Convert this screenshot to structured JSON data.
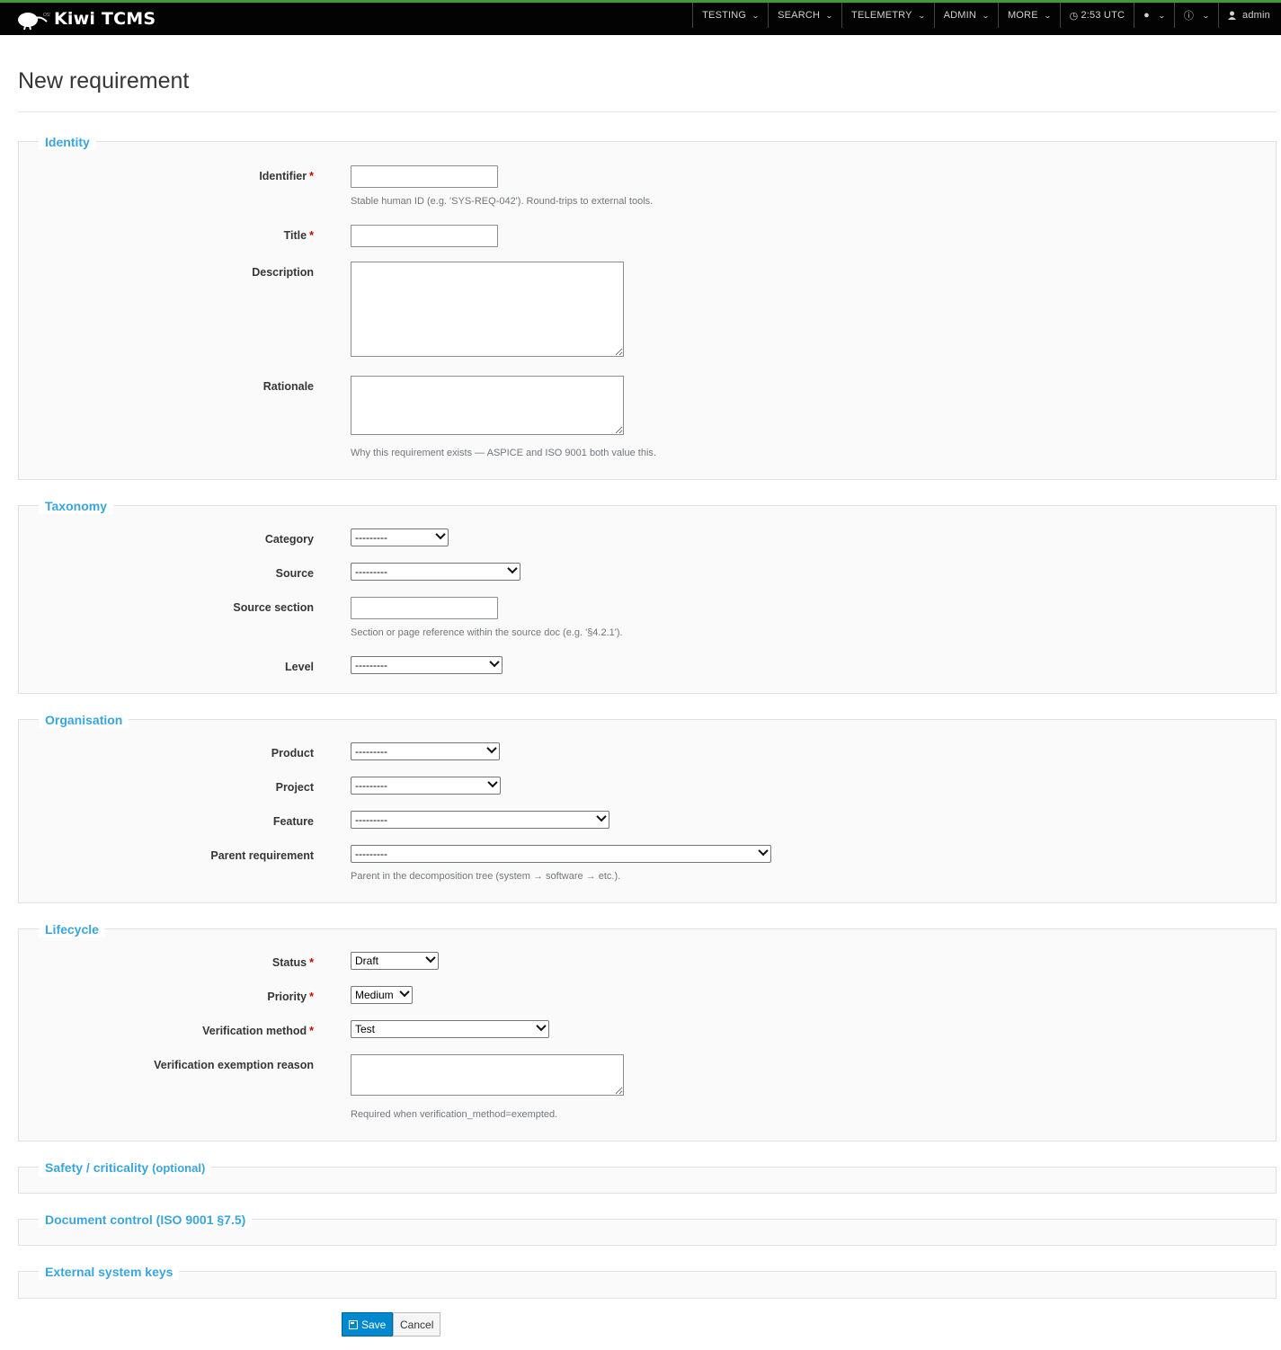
{
  "navbar": {
    "brand": "Kiwi TCMS",
    "items": [
      {
        "label": "TESTING"
      },
      {
        "label": "SEARCH"
      },
      {
        "label": "TELEMETRY"
      },
      {
        "label": "ADMIN"
      },
      {
        "label": "MORE"
      }
    ],
    "clock": "2:53 UTC",
    "user": "admin"
  },
  "page": {
    "title": "New requirement"
  },
  "sections": {
    "identity": {
      "legend": "Identity",
      "identifier_label": "Identifier",
      "identifier_help": "Stable human ID (e.g. 'SYS-REQ-042'). Round-trips to external tools.",
      "title_label": "Title",
      "description_label": "Description",
      "rationale_label": "Rationale",
      "rationale_help": "Why this requirement exists — ASPICE and ISO 9001 both value this."
    },
    "taxonomy": {
      "legend": "Taxonomy",
      "category_label": "Category",
      "category_value": "---------",
      "source_label": "Source",
      "source_value": "---------",
      "source_section_label": "Source section",
      "source_section_help": "Section or page reference within the source doc (e.g. '§4.2.1').",
      "level_label": "Level",
      "level_value": "---------"
    },
    "organisation": {
      "legend": "Organisation",
      "product_label": "Product",
      "product_value": "---------",
      "project_label": "Project",
      "project_value": "---------",
      "feature_label": "Feature",
      "feature_value": "---------",
      "parent_label": "Parent requirement",
      "parent_value": "---------",
      "parent_help": "Parent in the decomposition tree (system → software → etc.)."
    },
    "lifecycle": {
      "legend": "Lifecycle",
      "status_label": "Status",
      "status_value": "Draft",
      "priority_label": "Priority",
      "priority_value": "Medium",
      "verification_label": "Verification method",
      "verification_value": "Test",
      "exemption_label": "Verification exemption reason",
      "exemption_help": "Required when verification_method=exempted."
    },
    "safety": {
      "legend": "Safety / criticality",
      "legend_suffix": "(optional)"
    },
    "document_control": {
      "legend": "Document control (ISO 9001 §7.5)"
    },
    "external_keys": {
      "legend": "External system keys"
    }
  },
  "required_mark": "*",
  "actions": {
    "save_label": "Save",
    "cancel_label": "Cancel"
  },
  "colors": {
    "accent": "#39a5dc",
    "primary_button": "#0088ce",
    "navbar": "#030303",
    "required": "#cc0000"
  }
}
